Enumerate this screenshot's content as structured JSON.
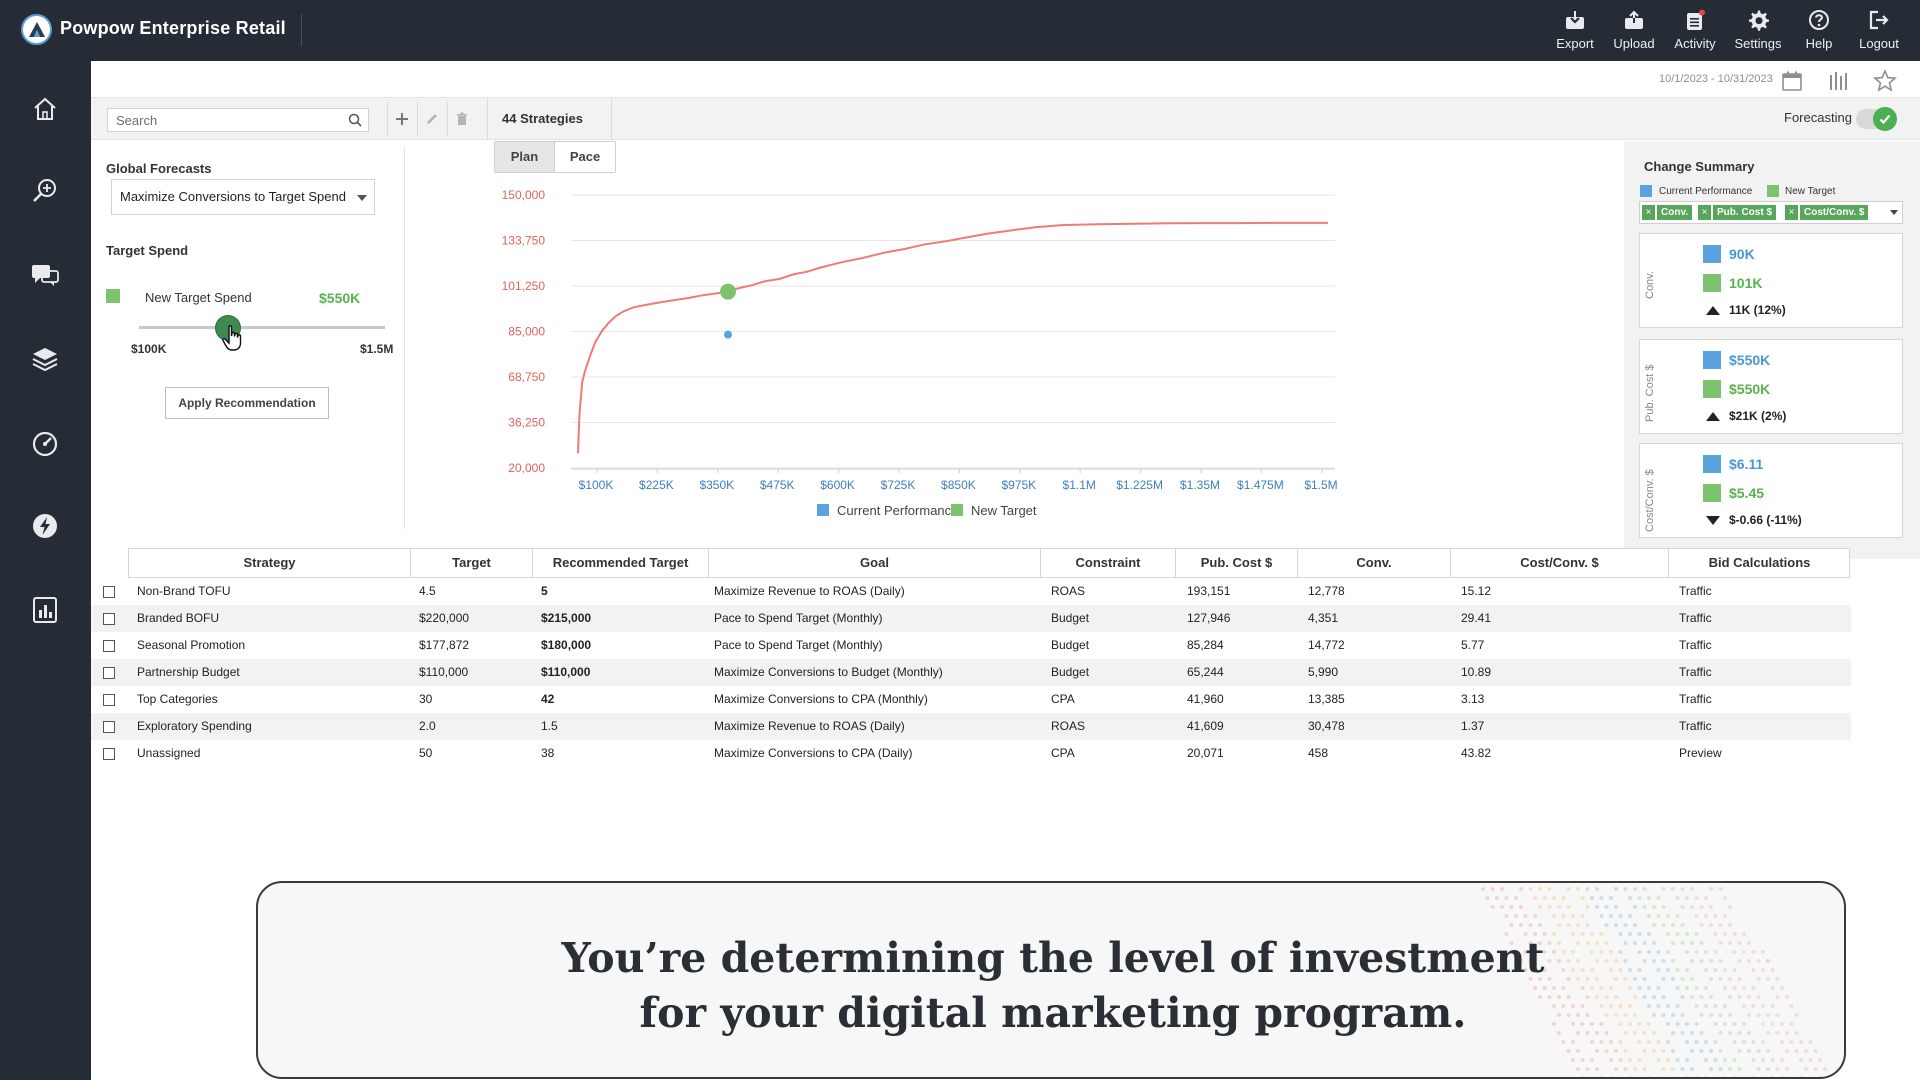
{
  "app": {
    "title": "Powpow Enterprise Retail"
  },
  "top_actions": [
    {
      "label": "Export",
      "icon": "export-icon"
    },
    {
      "label": "Upload",
      "icon": "upload-icon"
    },
    {
      "label": "Activity",
      "icon": "activity-icon"
    },
    {
      "label": "Settings",
      "icon": "gear-icon"
    },
    {
      "label": "Help",
      "icon": "help-icon"
    },
    {
      "label": "Logout",
      "icon": "logout-icon"
    }
  ],
  "side_nav": [
    "home-icon",
    "search-zoom-icon",
    "chat-icon",
    "layers-icon",
    "gauge-icon",
    "lightning-icon",
    "report-icon"
  ],
  "subheader": {
    "date_range": "10/1/2023 - 10/31/2023"
  },
  "toolbar": {
    "search_placeholder": "Search",
    "strategies_count": "44 Strategies",
    "forecasting_label": "Forecasting"
  },
  "left_panel": {
    "global_forecasts_title": "Global Forecasts",
    "forecast_selected": "Maximize Conversions to Target Spend",
    "target_spend_title": "Target Spend",
    "new_target_label": "New Target Spend",
    "new_target_value": "$550K",
    "slider_min": "$100K",
    "slider_max": "$1.5M",
    "slider_position": 0.36,
    "apply_label": "Apply Recommendation"
  },
  "chart_tabs": [
    "Plan",
    "Pace"
  ],
  "chart_data": {
    "type": "line",
    "x_tick_labels": [
      "$100K",
      "$225K",
      "$350K",
      "$475K",
      "$600K",
      "$725K",
      "$850K",
      "$975K",
      "$1.1M",
      "$1.225M",
      "$1.35M",
      "$1.475M",
      "$1.5M"
    ],
    "y_tick_labels": [
      "150,000",
      "133,750",
      "101,250",
      "85,000",
      "68,750",
      "36,250",
      "20,000"
    ],
    "curve_x": [
      0,
      2,
      6,
      10,
      18,
      25,
      35,
      45,
      55,
      65,
      80,
      100,
      120,
      140,
      160,
      180,
      200,
      216,
      230,
      250,
      270,
      290,
      310,
      330,
      350,
      380,
      410,
      440,
      470,
      500,
      530,
      560,
      590,
      620,
      660,
      700,
      750,
      800,
      850,
      900,
      950,
      1000,
      1050,
      1080
    ],
    "curve_y": [
      27000,
      45000,
      61000,
      66000,
      74000,
      80000,
      85500,
      89500,
      92500,
      94500,
      96500,
      97800,
      99000,
      100000,
      101000,
      102300,
      103200,
      104000,
      105500,
      107000,
      109000,
      110000,
      112200,
      113500,
      115500,
      118000,
      120000,
      122500,
      124300,
      126500,
      128000,
      129800,
      131600,
      133000,
      134700,
      135700,
      136100,
      136300,
      136500,
      136600,
      136600,
      136700,
      136700,
      136700
    ],
    "points": [
      {
        "series": "New Target",
        "x": 216,
        "y": 104000
      },
      {
        "series": "Current Performance",
        "x": 216,
        "y": 83500
      }
    ],
    "legend": [
      "Current Performance",
      "New Target"
    ],
    "colors": {
      "line": "#ee7b76",
      "current": "#5aa3e0",
      "new": "#7dc36e"
    }
  },
  "summary": {
    "title": "Change Summary",
    "legend_current": "Current Performance",
    "legend_new": "New Target",
    "chips": [
      "Conv.",
      "Pub. Cost $",
      "Cost/Conv. $"
    ],
    "cards": [
      {
        "axis": "Conv.",
        "current": "90K",
        "new": "101K",
        "delta": "11K  (12%)",
        "direction": "up"
      },
      {
        "axis": "Pub. Cost $",
        "current": "$550K",
        "new": "$550K",
        "delta": "$21K (2%)",
        "direction": "up"
      },
      {
        "axis": "Cost/Conv. $",
        "current": "$6.11",
        "new": "$5.45",
        "delta": "$-0.66 (-11%)",
        "direction": "down"
      }
    ]
  },
  "table": {
    "headers": [
      "Strategy",
      "Target",
      "Recommended Target",
      "Goal",
      "Constraint",
      "Pub. Cost $",
      "Conv.",
      "Cost/Conv. $",
      "Bid Calculations"
    ],
    "rows": [
      [
        "Non-Brand TOFU",
        "4.5",
        "5",
        "Maximize Revenue to ROAS (Daily)",
        "ROAS",
        "193,151",
        "12,778",
        "15.12",
        "Traffic"
      ],
      [
        "Branded BOFU",
        "$220,000",
        "$215,000",
        "Pace to Spend Target (Monthly)",
        "Budget",
        "127,946",
        "4,351",
        "29.41",
        "Traffic"
      ],
      [
        "Seasonal Promotion",
        "$177,872",
        "$180,000",
        "Pace to Spend Target (Monthly)",
        "Budget",
        "85,284",
        "14,772",
        "5.77",
        "Traffic"
      ],
      [
        "Partnership Budget",
        "$110,000",
        "$110,000",
        "Maximize Conversions to Budget (Monthly)",
        "Budget",
        "65,244",
        "5,990",
        "10.89",
        "Traffic"
      ],
      [
        "Top Categories",
        "30",
        "42",
        "Maximize Conversions to CPA (Monthly)",
        "CPA",
        "41,960",
        "13,385",
        "3.13",
        "Traffic"
      ],
      [
        "Exploratory Spending",
        "2.0",
        "1.5",
        "Maximize Revenue to ROAS (Daily)",
        "ROAS",
        "41,609",
        "30,478",
        "1.37",
        "Traffic"
      ],
      [
        "Unassigned",
        "50",
        "38",
        "Maximize Conversions to CPA (Daily)",
        "CPA",
        "20,071",
        "458",
        "43.82",
        "Preview"
      ]
    ],
    "bold_recommended_rows": [
      0,
      1,
      2,
      3,
      4
    ]
  },
  "caption": {
    "line1": "You’re determining the level of investment",
    "line2": "for your digital marketing program."
  }
}
